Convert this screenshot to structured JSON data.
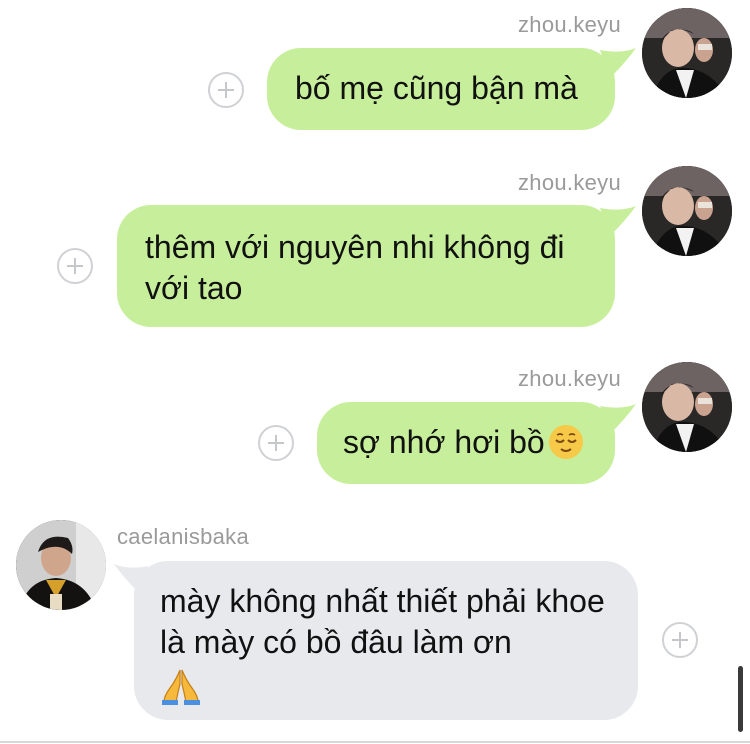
{
  "messages": [
    {
      "sender": "zhou.keyu",
      "text": "bố mẹ cũng bận mà",
      "direction": "outgoing",
      "avatar_icon": "profile-photo-icon"
    },
    {
      "sender": "zhou.keyu",
      "text": "thêm với nguyên nhi không đi với tao",
      "direction": "outgoing",
      "avatar_icon": "profile-photo-icon"
    },
    {
      "sender": "zhou.keyu",
      "text": "sợ nhớ hơi bồ",
      "emoji": "relieved-face-emoji",
      "direction": "outgoing",
      "avatar_icon": "profile-photo-icon"
    },
    {
      "sender": "caelanisbaka",
      "text": "mày không nhất thiết phải khoe là mày có bồ đâu làm ơn",
      "emoji": "folded-hands-emoji",
      "direction": "incoming",
      "avatar_icon": "profile-photo-icon"
    }
  ],
  "colors": {
    "outgoing_bubble": "#c7ef9b",
    "incoming_bubble": "#e7e9ec",
    "sender_text": "#9a9a9a",
    "plus_icon": "#c5c7ca"
  },
  "action_icon": "add-reaction-icon"
}
